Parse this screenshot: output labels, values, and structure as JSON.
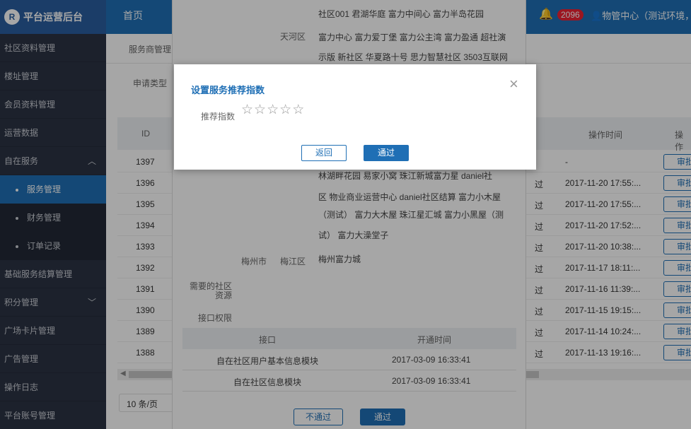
{
  "header": {
    "logo_mark": "R",
    "app_title": "平台运营后台",
    "home": "首页",
    "notification_count": "2096",
    "user": "物管中心（测试环境，"
  },
  "sidebar": {
    "items": [
      {
        "label": "社区资料管理"
      },
      {
        "label": "楼址管理"
      },
      {
        "label": "会员资料管理"
      },
      {
        "label": "运营数据"
      },
      {
        "label": "自在服务"
      },
      {
        "label": "服务管理"
      },
      {
        "label": "财务管理"
      },
      {
        "label": "订单记录"
      },
      {
        "label": "基础服务结算管理"
      },
      {
        "label": "积分管理"
      },
      {
        "label": "广场卡片管理"
      },
      {
        "label": "广告管理"
      },
      {
        "label": "操作日志"
      },
      {
        "label": "平台账号管理"
      }
    ]
  },
  "main": {
    "tab": "服务商管理",
    "filter_label": "申请类型",
    "table": {
      "headers": {
        "id": "ID",
        "op_time": "操作时间",
        "op": "操作"
      },
      "rows": [
        {
          "id": "1397",
          "status": "",
          "time": "-",
          "btn": "审批"
        },
        {
          "id": "1396",
          "status": "过",
          "time": "2017-11-20 17:55:...",
          "btn": "审批"
        },
        {
          "id": "1395",
          "status": "过",
          "time": "2017-11-20 17:55:...",
          "btn": "审批"
        },
        {
          "id": "1394",
          "status": "过",
          "time": "2017-11-20 17:52:...",
          "btn": "审批"
        },
        {
          "id": "1393",
          "status": "过",
          "time": "2017-11-20 10:38:...",
          "btn": "审批"
        },
        {
          "id": "1392",
          "status": "过",
          "time": "2017-11-17 18:11:...",
          "btn": "审批"
        },
        {
          "id": "1391",
          "status": "过",
          "time": "2017-11-16 11:39:...",
          "btn": "审批"
        },
        {
          "id": "1390",
          "status": "过",
          "time": "2017-11-15 19:15:...",
          "btn": "审批"
        },
        {
          "id": "1389",
          "status": "过",
          "time": "2017-11-14 10:24:...",
          "btn": "审批"
        },
        {
          "id": "1388",
          "status": "过",
          "time": "2017-11-13 19:16:...",
          "btn": "审批"
        }
      ]
    },
    "page_size": "10 条/页"
  },
  "detail": {
    "line_1": "社区001 君湖华庭 富力中间心 富力半岛花园",
    "district_tianhe": "天河区",
    "tianhe_line_1": "富力中心 富力爱丁堡 富力公主湾 富力盈通 超社演",
    "tianhe_line_2": "示版 新社区 华夏路十号 思力智慧社区 3503互联网",
    "more_line_1": "林湖畔花园 易家小窝 珠江新城富力星 daniel社",
    "more_line_2": "区 物业商业运营中心 daniel社区结算 富力小木屋",
    "more_line_3": "（测试） 富力大木屋 珠江星汇城 富力小黑屋（测",
    "more_line_4": "试） 富力大澡堂子",
    "city_meizhou": "梅州市",
    "district_meijiang": "梅江区",
    "meijiang_community": "梅州富力城",
    "need_community_label_1": "需要的社区",
    "need_community_label_2": "资源",
    "api_permission_label": "接口权限",
    "sub_table": {
      "headers": {
        "api": "接口",
        "open_time": "开通时间"
      },
      "rows": [
        {
          "api": "自在社区用户基本信息模块",
          "time": "2017-03-09 16:33:41"
        },
        {
          "api": "自在社区信息模块",
          "time": "2017-03-09 16:33:41"
        }
      ]
    },
    "reject_button": "不通过",
    "approve_button": "通过"
  },
  "dialog": {
    "title": "设置服务推荐指数",
    "rating_label": "推荐指数",
    "rating_value": 0,
    "rating_max": 5,
    "star_glyph": "☆",
    "back_button": "返回",
    "pass_button": "通过",
    "close_glyph": "×"
  }
}
